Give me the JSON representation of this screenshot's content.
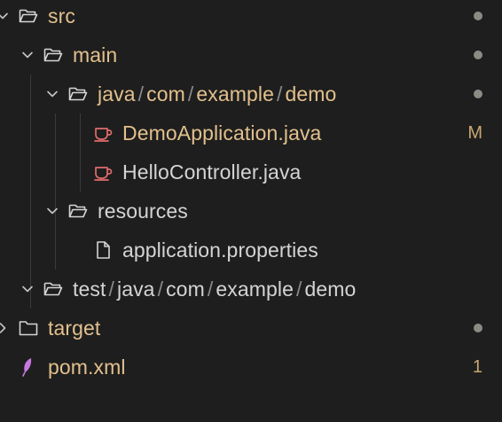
{
  "tree": {
    "items": [
      {
        "label": "src",
        "status": "dot"
      },
      {
        "label": "main",
        "status": "dot"
      },
      {
        "segments": [
          "java",
          "com",
          "example",
          "demo"
        ],
        "status": "dot"
      },
      {
        "label": "DemoApplication.java",
        "badge": "M"
      },
      {
        "label": "HelloController.java"
      },
      {
        "label": "resources"
      },
      {
        "label": "application.properties"
      },
      {
        "segments": [
          "test",
          "java",
          "com",
          "example",
          "demo"
        ]
      },
      {
        "label": "target",
        "status": "dot"
      },
      {
        "label": "pom.xml",
        "badge": "1"
      }
    ],
    "separator": "/"
  },
  "icons": {
    "folder_open": "folder-open-icon",
    "folder_closed": "folder-icon",
    "java_file": "java-cup-icon",
    "properties_file": "file-icon",
    "maven_file": "maven-feather-icon",
    "chevron_down": "chevron-down-icon",
    "chevron_right": "chevron-right-icon"
  },
  "colors": {
    "background": "#1e1e1e",
    "modified_text": "#e2c08d",
    "normal_text": "#d4d4d4",
    "separator": "#8a8a8a",
    "badge": "#c9a770",
    "dot": "#8b8b84",
    "java_icon": "#e06c6c",
    "maven_icon": "#c678dd"
  }
}
